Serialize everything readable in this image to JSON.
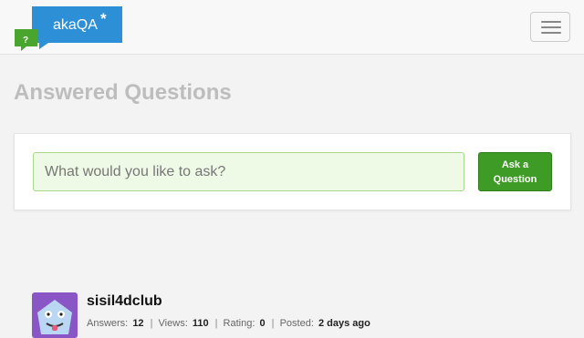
{
  "header": {
    "brand": "akaQA",
    "brand_star": "*",
    "logo_badge": "?"
  },
  "page": {
    "title": "Answered Questions"
  },
  "ask": {
    "placeholder": "What would you like to ask?",
    "button_label": "Ask a\nQuestion"
  },
  "question": {
    "username": "sisil4dclub",
    "answers_label": "Answers:",
    "answers": "12",
    "views_label": "Views:",
    "views": "110",
    "rating_label": "Rating:",
    "rating": "0",
    "posted_label": "Posted:",
    "posted": "2 days ago"
  },
  "colors": {
    "brand_blue": "#2d8fd6",
    "brand_green": "#4aa52e",
    "ask_button": "#3e9b25",
    "input_bg": "#effae6"
  }
}
